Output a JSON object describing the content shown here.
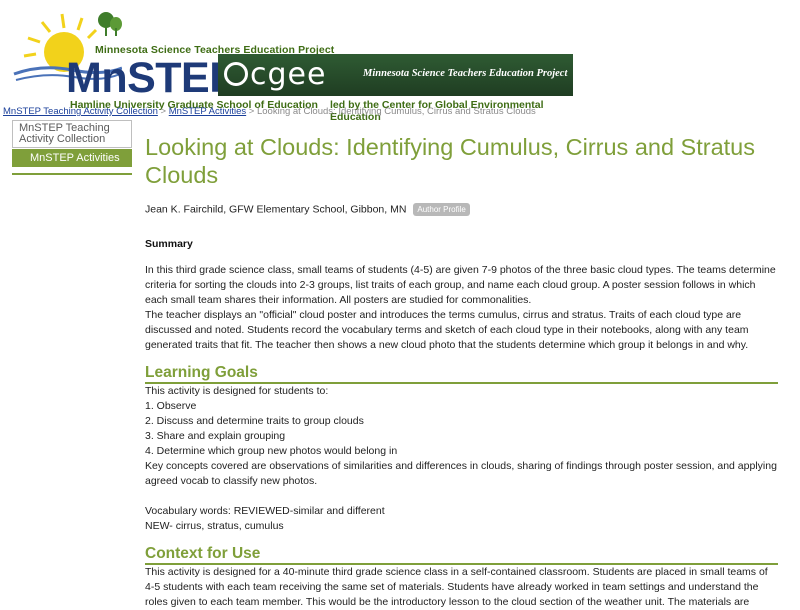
{
  "header": {
    "org_top": "Minnesota Science Teachers Education Project",
    "logo_word": "MnSTEP",
    "hamline": "Hamline University Graduate School of Education",
    "cgee_logo": "cgee",
    "cgee_tag": "Minnesota Science Teachers Education Project",
    "cgee_sub": "led by the Center for Global Environmental Education"
  },
  "breadcrumb": {
    "item1": "MnSTEP Teaching Activity Collection",
    "sep1": " > ",
    "item2": "MnSTEP Activities",
    "sep2": " > ",
    "current": "Looking at Clouds: Identifying Cumulus, Cirrus and Stratus Clouds"
  },
  "sidebar": {
    "items": [
      {
        "label": "MnSTEP Teaching Activity Collection"
      },
      {
        "label": "MnSTEP Activities"
      }
    ]
  },
  "main": {
    "title": "Looking at Clouds: Identifying Cumulus, Cirrus and Stratus Clouds",
    "author": "Jean K. Fairchild, GFW Elementary School, Gibbon, MN",
    "author_button": "Author Profile",
    "summary_heading": "Summary",
    "summary_p1": "In this third grade science class, small teams of students (4-5) are given 7-9 photos of the three basic cloud types. The teams determine criteria for sorting the clouds into 2-3 groups, list traits of each group, and name each cloud group. A poster session follows in which each small team shares their information. All posters are studied for commonalities.",
    "summary_p2": "The teacher displays an \"official\" cloud poster and introduces the terms cumulus, cirrus and stratus. Traits of each cloud type are discussed and noted. Students record the vocabulary terms and sketch of each cloud type in their notebooks, along with any team generated traits that fit. The teacher then shows a new cloud photo that the students determine which group it belongs in and why.",
    "learning_goals_heading": "Learning Goals",
    "lg_intro": "This activity is designed for students to:",
    "lg_items": [
      "1. Observe",
      "2. Discuss and determine traits to group clouds",
      "3. Share and explain grouping",
      "4. Determine which group new photos would belong in"
    ],
    "lg_key_concepts": "Key concepts covered are observations of similarities and differences in clouds, sharing of findings through poster session, and applying agreed vocab to classify new photos.",
    "lg_vocab1": "Vocabulary words: REVIEWED-similar and different",
    "lg_vocab2": "NEW- cirrus, stratus, cumulus",
    "context_heading": "Context for Use",
    "context_p": "This activity is designed for a 40-minute third grade science class in a self-contained classroom. Students are placed in small teams of 4-5 students with each team receiving the same set of materials. Students have already worked in team settings and understand the roles given to each team member. This would be the introductory lesson to the cloud section of the weather unit. The materials are"
  }
}
